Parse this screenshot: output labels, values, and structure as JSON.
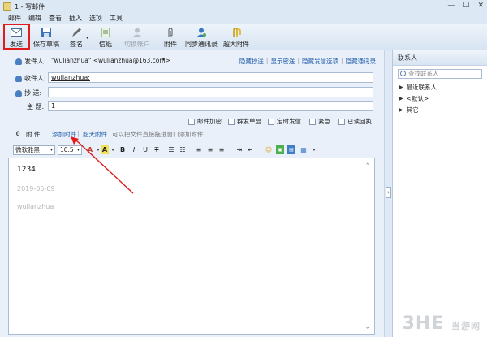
{
  "window": {
    "title": "1 - 写邮件",
    "controls": [
      "—",
      "☐",
      "✕"
    ]
  },
  "menu": [
    "邮件",
    "编辑",
    "查看",
    "插入",
    "选项",
    "工具"
  ],
  "toolbar": {
    "send": "发送",
    "save_draft": "保存草稿",
    "signature": "签名",
    "stationery": "信纸",
    "switch_account": "切换帐户",
    "attachment": "附件",
    "sync_contacts": "同步通讯录",
    "large_attachment": "超大附件"
  },
  "header": {
    "from_label": "发件人:",
    "from_value": "\"wulianzhua\" <wulianzhua@163.com>",
    "links": [
      "隐藏抄送",
      "显示密送",
      "隐藏发信选项",
      "隐藏通讯录"
    ],
    "to_label": "收件人:",
    "to_value": "wulianzhua;",
    "cc_label": "抄 送:",
    "cc_value": "",
    "subject_label": "主 题:",
    "subject_value": "1"
  },
  "options": [
    "邮件加密",
    "群发单显",
    "定时发信",
    "紧急",
    "已读回执"
  ],
  "attach": {
    "label": "附 件:",
    "add": "添加附件",
    "large": "超大附件",
    "hint": "可以把文件直接拖进窗口添加附件"
  },
  "format": {
    "font": "微软雅黑",
    "size": "10.5"
  },
  "editor": {
    "body": "1234",
    "date": "2019-05-09",
    "signature": "wulianzhua"
  },
  "contacts": {
    "title": "联系人",
    "search_placeholder": "查找联系人",
    "groups": [
      "最近联系人",
      "<默认>",
      "其它"
    ]
  },
  "watermark": {
    "main": "3HE",
    "site": "当游网"
  },
  "colors": {
    "accent": "#1d5aa8",
    "highlight": "#e01c1c"
  }
}
